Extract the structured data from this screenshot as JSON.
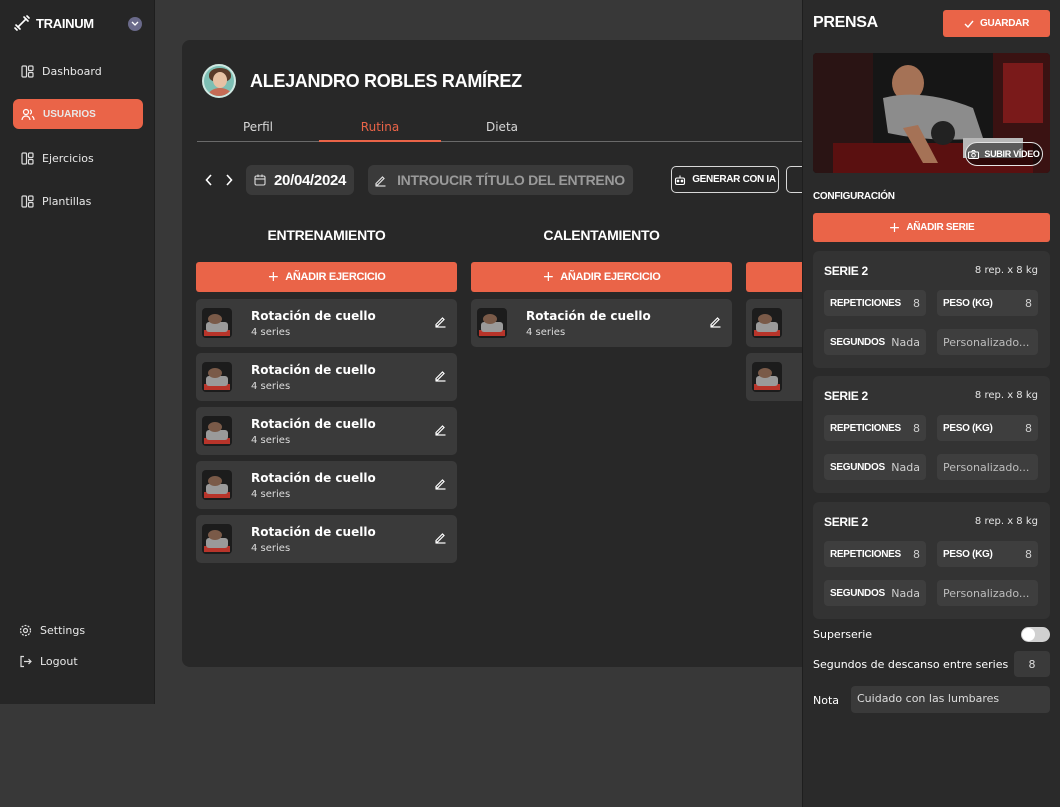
{
  "brand": {
    "name": "TRAINUM"
  },
  "nav": [
    {
      "label": "Dashboard"
    },
    {
      "label": "USUARIOS"
    },
    {
      "label": "Ejercicios"
    },
    {
      "label": "Plantillas"
    }
  ],
  "footer_nav": {
    "settings": "Settings",
    "logout": "Logout"
  },
  "profile": {
    "name": "ALEJANDRO ROBLES RAMÍREZ"
  },
  "tabs": [
    "Perfil",
    "Rutina",
    "Dieta"
  ],
  "toolbar": {
    "date": "20/04/2024",
    "title_placeholder": "INTROUCIR TÍTULO DEL ENTRENO",
    "generate_label": "GENERAR CON IA"
  },
  "columns": [
    {
      "title": "ENTRENAMIENTO",
      "add_label": "AÑADIR EJERCICIO",
      "exercises": [
        {
          "name": "Rotación de cuello",
          "sets": "4 series"
        },
        {
          "name": "Rotación de cuello",
          "sets": "4 series"
        },
        {
          "name": "Rotación de cuello",
          "sets": "4 series"
        },
        {
          "name": "Rotación de cuello",
          "sets": "4 series"
        },
        {
          "name": "Rotación de cuello",
          "sets": "4 series"
        }
      ]
    },
    {
      "title": "CALENTAMIENTO",
      "add_label": "AÑADIR EJERCICIO",
      "exercises": [
        {
          "name": "Rotación de cuello",
          "sets": "4 series"
        }
      ]
    }
  ],
  "panel": {
    "title": "PRENSA",
    "save_label": "GUARDAR",
    "upload_label": "SUBIR VÍDEO",
    "config_label": "CONFIGURACIÓN",
    "add_serie_label": "AÑADIR SERIE",
    "series": [
      {
        "title": "SERIE 2",
        "summary": "8 rep. x 8 kg",
        "reps_label": "REPETICIONES",
        "reps": "8",
        "weight_label": "PESO (KG)",
        "weight": "8",
        "seconds_label": "SEGUNDOS",
        "seconds": "Nada",
        "custom": "Personalizado..."
      },
      {
        "title": "SERIE 2",
        "summary": "8 rep. x 8 kg",
        "reps_label": "REPETICIONES",
        "reps": "8",
        "weight_label": "PESO (KG)",
        "weight": "8",
        "seconds_label": "SEGUNDOS",
        "seconds": "Nada",
        "custom": "Personalizado..."
      },
      {
        "title": "SERIE 2",
        "summary": "8 rep. x 8 kg",
        "reps_label": "REPETICIONES",
        "reps": "8",
        "weight_label": "PESO (KG)",
        "weight": "8",
        "seconds_label": "SEGUNDOS",
        "seconds": "Nada",
        "custom": "Personalizado..."
      }
    ],
    "superserie_label": "Superserie",
    "superserie_on": false,
    "rest_label": "Segundos de descanso entre series",
    "rest_value": "8",
    "nota_label": "Nota",
    "nota_value": "Cuidado con las lumbares"
  },
  "colors": {
    "accent": "#ea6448",
    "background": "#383838",
    "sidebar": "#262626",
    "card": "#282828"
  }
}
